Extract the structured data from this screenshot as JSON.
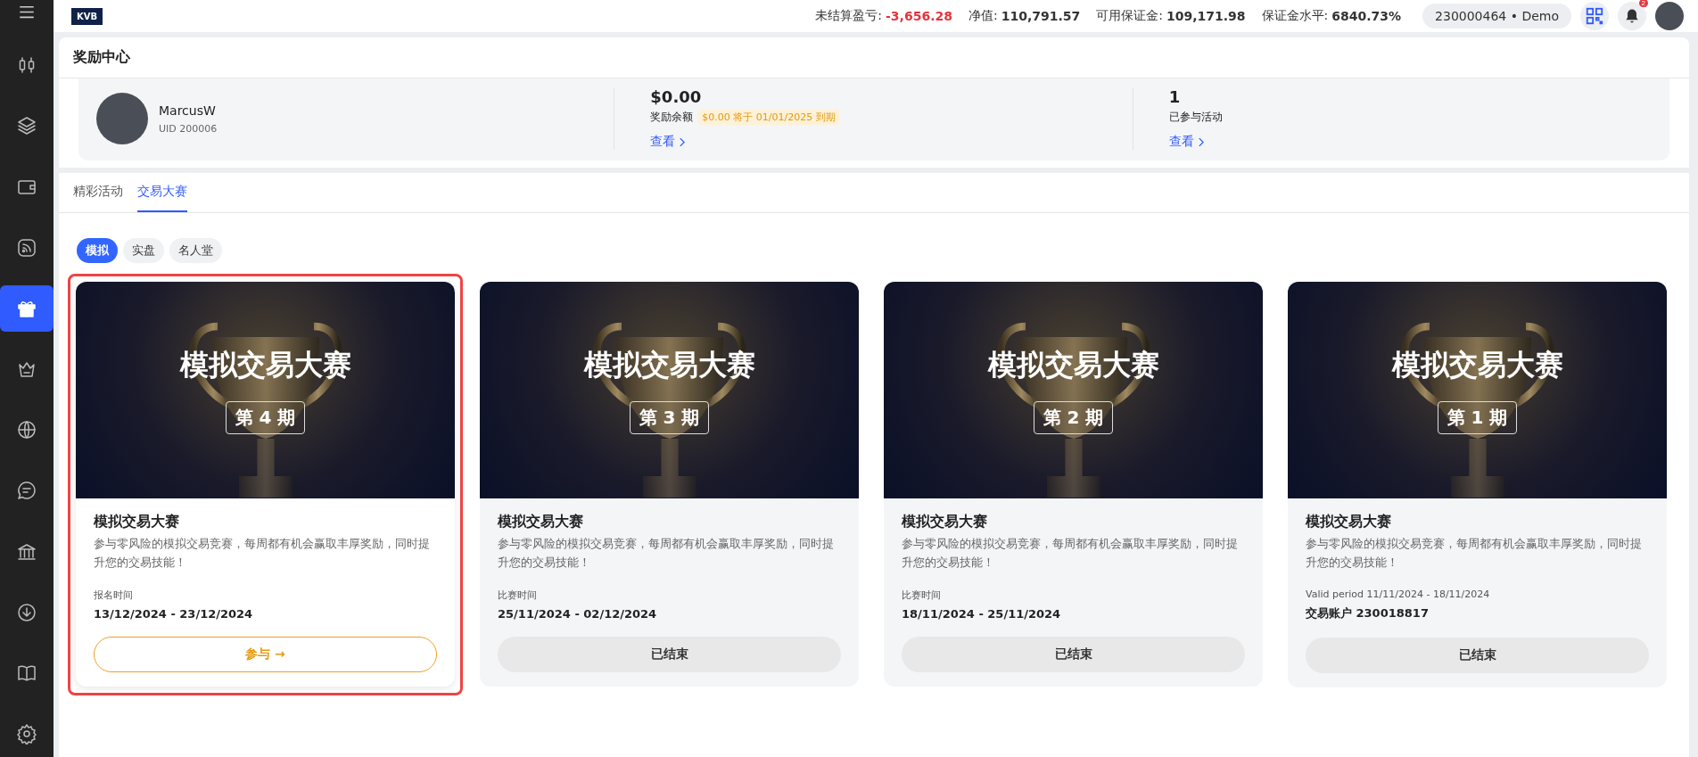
{
  "sidebar": {
    "items": [
      {
        "selected": false
      },
      {
        "selected": false
      },
      {
        "selected": false
      },
      {
        "selected": false
      },
      {
        "selected": true
      },
      {
        "selected": false
      },
      {
        "selected": false
      },
      {
        "selected": false
      },
      {
        "selected": false
      },
      {
        "selected": false
      },
      {
        "selected": false
      },
      {
        "selected": false
      }
    ]
  },
  "topbar": {
    "logo": "KVB",
    "stats": [
      {
        "label": "未结算盈亏:",
        "value": "-3,656.28",
        "kind": "negative"
      },
      {
        "label": "净值:",
        "value": "110,791.57",
        "kind": "plain"
      },
      {
        "label": "可用保证金:",
        "value": "109,171.98",
        "kind": "plain"
      },
      {
        "label": "保证金水平:",
        "value": "6840.73%",
        "kind": "plain"
      }
    ],
    "account": "230000464 • Demo",
    "notification_badge": "2"
  },
  "page_title": "奖励中心",
  "profile": {
    "name": "MarcusW",
    "uid": "UID 200006",
    "stats": [
      {
        "value": "$0.00",
        "label": "奖励余额",
        "tag": "$0.00 将于 01/01/2025 到期",
        "link": "查看"
      },
      {
        "value": "1",
        "label": "已参与活动",
        "link": "查看"
      }
    ]
  },
  "tabs": [
    {
      "label": "精彩活动",
      "selected": false
    },
    {
      "label": "交易大赛",
      "selected": true
    }
  ],
  "filters": [
    {
      "label": "模拟",
      "selected": true
    },
    {
      "label": "实盘",
      "selected": false
    },
    {
      "label": "名人堂",
      "selected": false
    }
  ],
  "cards": [
    {
      "banner_title": "模拟交易大赛",
      "period": "第 4 期",
      "title": "模拟交易大赛",
      "description": "参与零风险的模拟交易竞赛，每周都有机会赢取丰厚奖励，同时提升您的交易技能！",
      "meta_label": "报名时间",
      "meta_value": "13/12/2024 - 23/12/2024",
      "button": "参与 →",
      "kind": "open",
      "highlighted": true
    },
    {
      "banner_title": "模拟交易大赛",
      "period": "第 3 期",
      "title": "模拟交易大赛",
      "description": "参与零风险的模拟交易竞赛，每周都有机会赢取丰厚奖励，同时提升您的交易技能！",
      "meta_label": "比赛时间",
      "meta_value": "25/11/2024 - 02/12/2024",
      "button": "已结束",
      "kind": "ended",
      "highlighted": false
    },
    {
      "banner_title": "模拟交易大赛",
      "period": "第 2 期",
      "title": "模拟交易大赛",
      "description": "参与零风险的模拟交易竞赛，每周都有机会赢取丰厚奖励，同时提升您的交易技能！",
      "meta_label": "比赛时间",
      "meta_value": "18/11/2024 - 25/11/2024",
      "button": "已结束",
      "kind": "ended",
      "highlighted": false
    },
    {
      "banner_title": "模拟交易大赛",
      "period": "第 1 期",
      "title": "模拟交易大赛",
      "description": "参与零风险的模拟交易竞赛，每周都有机会赢取丰厚奖励，同时提升您的交易技能！",
      "meta_label": "Valid period 11/11/2024 - 18/11/2024",
      "meta_value": "交易账户 230018817",
      "button": "已结束",
      "kind": "ended",
      "highlighted": false
    }
  ]
}
